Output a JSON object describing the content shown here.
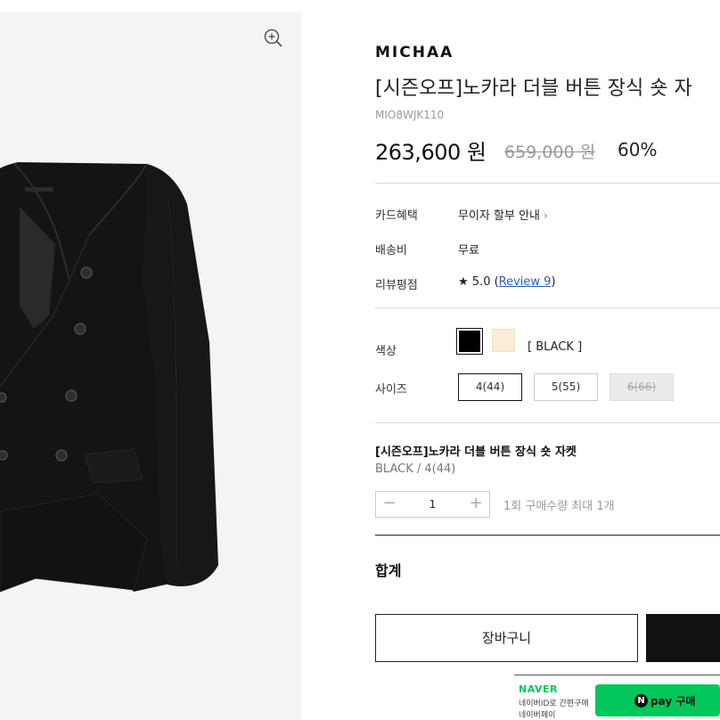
{
  "product": {
    "brand": "MICHAA",
    "title": "[시즌오프]노카라 더블 버튼 장식 숏 자",
    "code": "MIO8WJK110",
    "price": "263,600 원",
    "original_price": "659,000 원",
    "discount": "60%"
  },
  "info_rows": [
    {
      "label": "카드혜택",
      "value": "무이자 할부 안내"
    },
    {
      "label": "배송비",
      "value": "무료"
    },
    {
      "label": "리뷰평점",
      "value_prefix": "★ 5.0 (",
      "link": "Review 9",
      "value_suffix": ")"
    }
  ],
  "color": {
    "label": "색상",
    "selected_name": "[ BLACK ]",
    "swatches": [
      "#000000",
      "#fbecd6"
    ]
  },
  "size": {
    "label": "사이즈",
    "options": [
      {
        "label": "4(44)",
        "state": "selected"
      },
      {
        "label": "5(55)",
        "state": "available"
      },
      {
        "label": "6(66)",
        "state": "soldout"
      }
    ]
  },
  "selected_option": {
    "title": "[시즌오프]노카라 더블 버튼 장식 숏 자켓",
    "subtitle": "BLACK / 4(44)",
    "quantity": "1",
    "minus": "−",
    "plus": "+",
    "limit_note": "1회 구매수량 최대 1개"
  },
  "total_label": "합계",
  "buttons": {
    "cart": "장바구니"
  },
  "naver": {
    "logo": "NAVER",
    "line1": "네이버ID로 간편구매",
    "line2": "네이버페이",
    "npay_n": "N",
    "npay_label": "pay 구매"
  },
  "icons": {
    "zoom": "zoom-in-icon",
    "chevron": "chevron-right-icon"
  }
}
